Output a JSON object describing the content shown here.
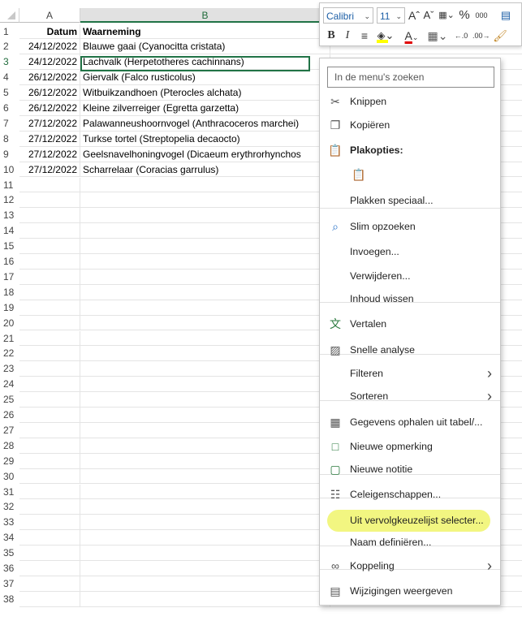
{
  "sheet": {
    "columns": [
      "A",
      "B",
      ""
    ],
    "selected_row": 3,
    "rows": [
      {
        "num": "1",
        "a": "Datum",
        "b": "Waarneming",
        "bold": true
      },
      {
        "num": "2",
        "a": "24/12/2022",
        "b": "Blauwe gaai (Cyanocitta cristata)"
      },
      {
        "num": "3",
        "a": "24/12/2022",
        "b": "Lachvalk (Herpetotheres cachinnans)"
      },
      {
        "num": "4",
        "a": "26/12/2022",
        "b": "Giervalk (Falco rusticolus)"
      },
      {
        "num": "5",
        "a": "26/12/2022",
        "b": "Witbuikzandhoen (Pterocles alchata)"
      },
      {
        "num": "6",
        "a": "26/12/2022",
        "b": "Kleine zilverreiger (Egretta garzetta)"
      },
      {
        "num": "7",
        "a": "27/12/2022",
        "b": "Palawanneushoornvogel (Anthracoceros marchei)"
      },
      {
        "num": "8",
        "a": "27/12/2022",
        "b": "Turkse tortel (Streptopelia decaocto)"
      },
      {
        "num": "9",
        "a": "27/12/2022",
        "b": "Geelsnavelhoningvogel (Dicaeum erythrorhynchos"
      },
      {
        "num": "10",
        "a": "27/12/2022",
        "b": "Scharrelaar (Coracias garrulus)"
      },
      {
        "num": "11"
      },
      {
        "num": "12"
      },
      {
        "num": "13"
      },
      {
        "num": "14"
      },
      {
        "num": "15"
      },
      {
        "num": "16"
      },
      {
        "num": "17"
      },
      {
        "num": "18"
      },
      {
        "num": "19"
      },
      {
        "num": "20"
      },
      {
        "num": "21"
      },
      {
        "num": "22"
      },
      {
        "num": "23"
      },
      {
        "num": "24"
      },
      {
        "num": "25"
      },
      {
        "num": "26"
      },
      {
        "num": "27"
      },
      {
        "num": "28"
      },
      {
        "num": "29"
      },
      {
        "num": "30"
      },
      {
        "num": "31"
      },
      {
        "num": "32"
      },
      {
        "num": "33"
      },
      {
        "num": "34"
      },
      {
        "num": "35"
      },
      {
        "num": "36"
      },
      {
        "num": "37"
      },
      {
        "num": "38"
      }
    ]
  },
  "mini_toolbar": {
    "font_name": "Calibri",
    "font_size": "11",
    "grow_font": "Aˆ",
    "shrink_font": "Aˇ",
    "percent": "%",
    "thousands": "000",
    "bold": "B",
    "italic": "I",
    "font_color_letter": "A",
    "fill_color": "#ffff00",
    "font_color": "#e00000",
    "icons": [
      "number-format-icon",
      "cell-styles-icon",
      "align-center-icon",
      "fill-color-icon",
      "borders-icon",
      "increase-decimal-icon",
      "decrease-decimal-icon",
      "format-painter-icon"
    ]
  },
  "context_menu": {
    "search_placeholder": "In de menu's zoeken",
    "items": [
      {
        "label": "Knippen",
        "icon": "scissors-icon"
      },
      {
        "label": "Kopiëren",
        "icon": "copy-icon"
      },
      {
        "label": "Plakopties:",
        "icon": "paste-icon",
        "header": true
      },
      {
        "label": "",
        "icon": "paste-option-icon"
      },
      {
        "label": "Plakken speciaal...",
        "icon": ""
      },
      {
        "label": "Slim opzoeken",
        "icon": "smart-lookup-icon"
      },
      {
        "label": "Invoegen...",
        "icon": ""
      },
      {
        "label": "Verwijderen...",
        "icon": ""
      },
      {
        "label": "Inhoud wissen",
        "icon": ""
      },
      {
        "label": "Vertalen",
        "icon": "translate-icon"
      },
      {
        "label": "Snelle analyse",
        "icon": "quick-analysis-icon"
      },
      {
        "label": "Filteren",
        "icon": "",
        "submenu": true
      },
      {
        "label": "Sorteren",
        "icon": "",
        "submenu": true
      },
      {
        "label": "Gegevens ophalen uit tabel/...",
        "icon": "table-data-icon"
      },
      {
        "label": "Nieuwe opmerking",
        "icon": "new-comment-icon"
      },
      {
        "label": "Nieuwe notitie",
        "icon": "new-note-icon"
      },
      {
        "label": "Celeigenschappen...",
        "icon": "cell-properties-icon"
      },
      {
        "label": "Uit vervolgkeuzelijst selecter...",
        "icon": "",
        "highlighted": true
      },
      {
        "label": "Naam definiëren...",
        "icon": ""
      },
      {
        "label": "Koppeling",
        "icon": "link-icon",
        "submenu": true
      },
      {
        "label": "Wijzigingen weergeven",
        "icon": "show-changes-icon"
      }
    ],
    "highlight_color": "#f1f57a"
  }
}
